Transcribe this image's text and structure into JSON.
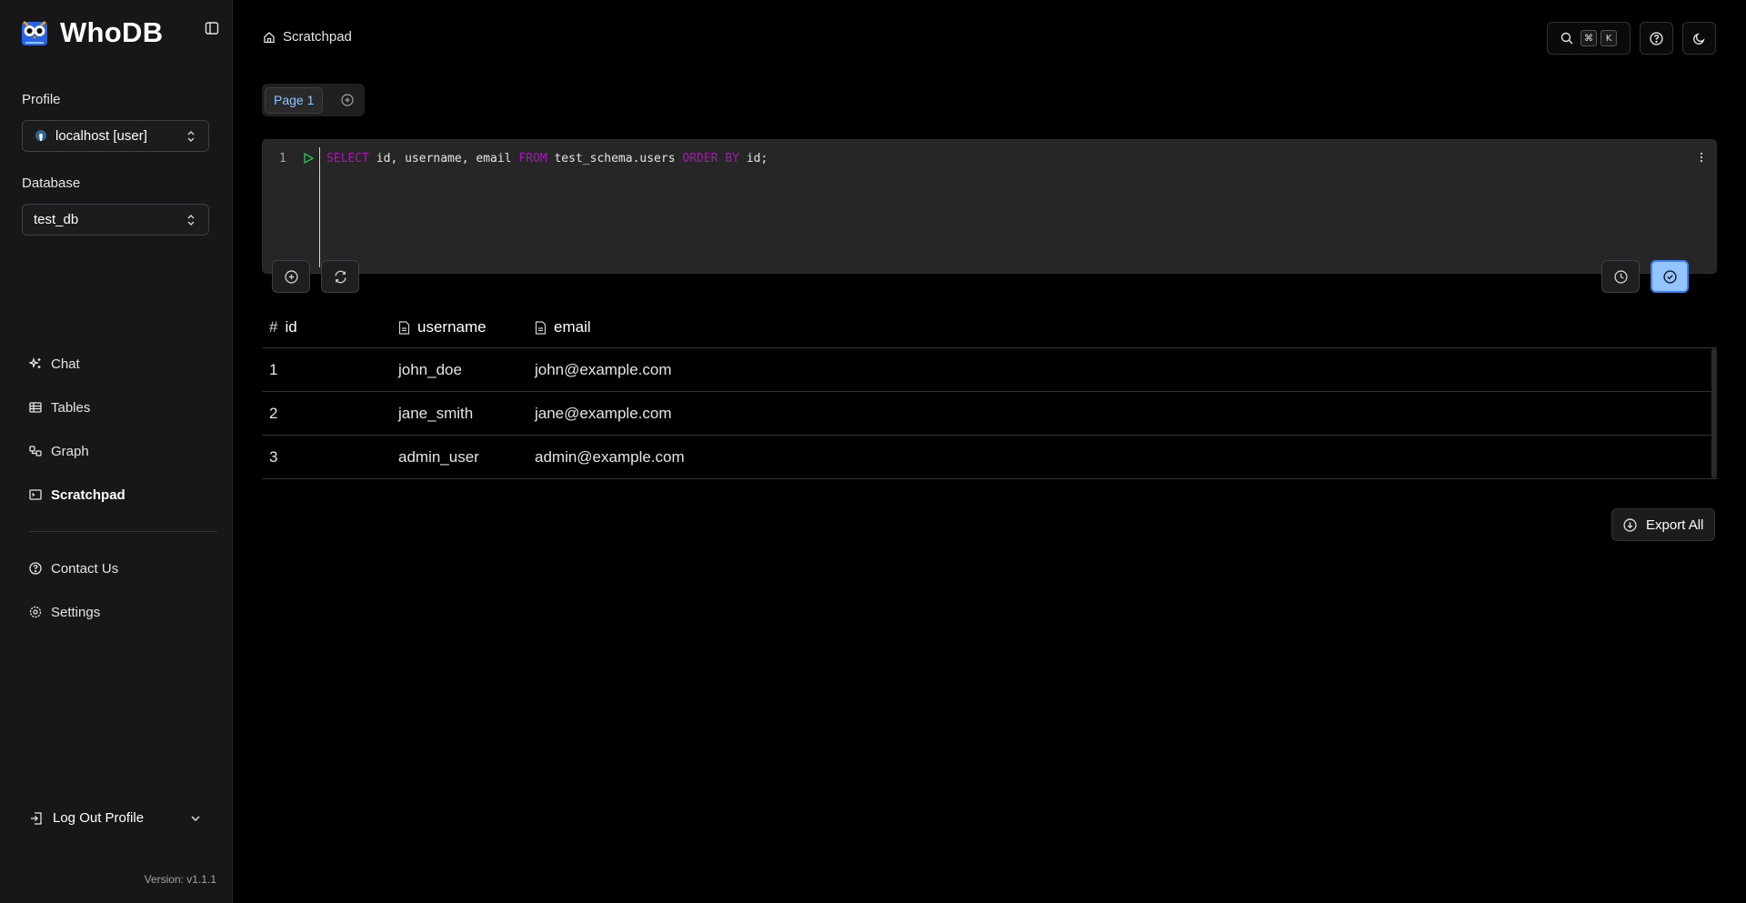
{
  "app": {
    "name": "WhoDB",
    "version": "Version: v1.1.1"
  },
  "sidebar": {
    "profile_label": "Profile",
    "profile_value": "localhost [user]",
    "database_label": "Database",
    "database_value": "test_db",
    "nav": [
      {
        "label": "Chat",
        "icon": "sparkles-icon"
      },
      {
        "label": "Tables",
        "icon": "table-icon"
      },
      {
        "label": "Graph",
        "icon": "graph-icon"
      },
      {
        "label": "Scratchpad",
        "icon": "terminal-icon",
        "active": true
      },
      {
        "label": "Contact Us",
        "icon": "help-icon"
      },
      {
        "label": "Settings",
        "icon": "gear-icon"
      }
    ],
    "logout_label": "Log Out Profile"
  },
  "header": {
    "breadcrumb": "Scratchpad",
    "shortcut_keys": [
      "⌘",
      "K"
    ]
  },
  "scratchpad": {
    "pages": [
      "Page 1"
    ],
    "line_number": "1",
    "query_parts": [
      {
        "text": "SELECT",
        "kw": true
      },
      {
        "text": " id, username, email ",
        "kw": false
      },
      {
        "text": "FROM",
        "kw": true
      },
      {
        "text": " test_schema.users ",
        "kw": false
      },
      {
        "text": "ORDER BY",
        "kw": true
      },
      {
        "text": " id;",
        "kw": false
      }
    ]
  },
  "results": {
    "columns": [
      {
        "name": "id",
        "icon": "hash-icon"
      },
      {
        "name": "username",
        "icon": "file-text-icon"
      },
      {
        "name": "email",
        "icon": "file-text-icon"
      }
    ],
    "rows": [
      [
        "1",
        "john_doe",
        "john@example.com"
      ],
      [
        "2",
        "jane_smith",
        "jane@example.com"
      ],
      [
        "3",
        "admin_user",
        "admin@example.com"
      ]
    ],
    "export_label": "Export All"
  },
  "colors": {
    "accent": "#93c5fd",
    "keyword": "#a21caf",
    "run": "#22c55e"
  }
}
